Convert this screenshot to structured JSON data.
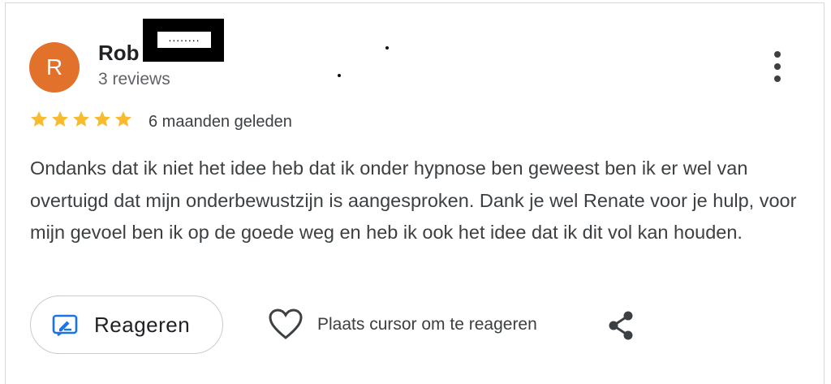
{
  "review": {
    "avatar_letter": "R",
    "avatar_color": "#e1712b",
    "author_name": "Rob",
    "author_surname_redacted": "........",
    "reviews_count": "3 reviews",
    "rating": 5,
    "rating_max": 5,
    "star_color": "#f6bb2f",
    "time_ago": "6 maanden geleden",
    "text": "Ondanks dat ik niet het idee heb dat ik onder hypnose ben geweest ben ik er wel van overtuigd dat mijn onderbewustzijn is aangesproken. Dank je wel Renate voor je hulp, voor mijn gevoel ben ik op de goede weg en heb ik ook het idee dat ik dit vol kan houden."
  },
  "actions": {
    "reply_label": "Reageren",
    "reply_icon": "edit-reply-icon",
    "like_hint": "Plaats cursor om te reageren",
    "like_icon": "heart-icon",
    "share_icon": "share-icon",
    "more_icon": "more-vert-icon",
    "accent_color": "#1a73e8"
  }
}
